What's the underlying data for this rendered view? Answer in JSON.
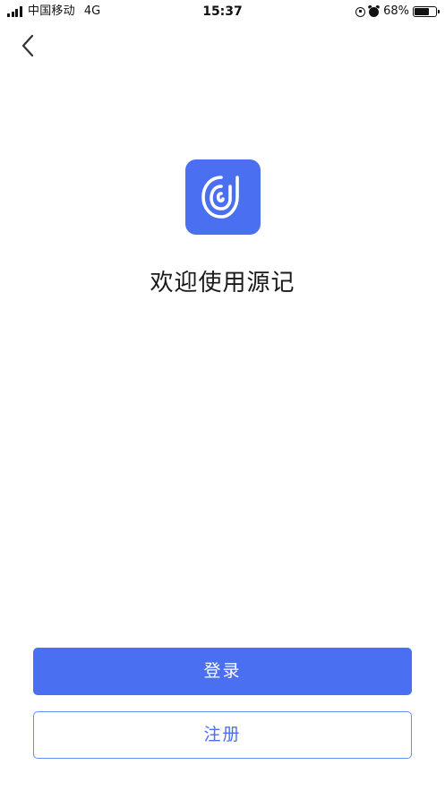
{
  "status_bar": {
    "carrier": "中国移动",
    "network": "4G",
    "time": "15:37",
    "battery_percent": "68%",
    "battery_level": 0.68,
    "icons": [
      "signal-strength-icon",
      "rotation-lock-icon",
      "alarm-icon",
      "battery-icon"
    ]
  },
  "nav": {
    "back_icon": "chevron-left-icon"
  },
  "app": {
    "logo_icon": "app-logo-icon",
    "welcome_text": "欢迎使用源记"
  },
  "actions": {
    "login_label": "登录",
    "register_label": "注册"
  },
  "colors": {
    "accent": "#4a6ff0",
    "register_border": "#6b8cf3",
    "register_text": "#4a6ff0",
    "background": "#ffffff"
  }
}
